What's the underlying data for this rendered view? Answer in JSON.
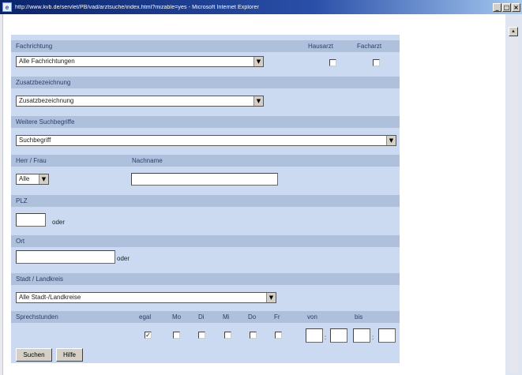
{
  "window": {
    "title": "http://www.kvb.de/servlet/PB/vad/arztsuche/index.html?mizable=yes - Microsoft Internet Explorer",
    "icon": "ie-icon",
    "minimize": "_",
    "restore": "□",
    "close": "×"
  },
  "form": {
    "fachrichtung": {
      "header": "Fachrichtung",
      "hausarzt": "Hausarzt",
      "facharzt": "Facharzt",
      "select_value": "Alle Fachrichtungen"
    },
    "zusatz": {
      "header": "Zusatzbezeichnung",
      "select_value": "Zusatzbezeichnung"
    },
    "suchbegriffe": {
      "header": "Weitere Suchbegriffe",
      "select_value": "Suchbegriff"
    },
    "person": {
      "herr_frau": "Herr / Frau",
      "nachname": "Nachname",
      "anrede_value": "Alle"
    },
    "plz": {
      "header": "PLZ",
      "oder": "oder"
    },
    "ort": {
      "header": "Ort",
      "oder": "oder"
    },
    "kreis": {
      "header": "Stadt / Landkreis",
      "select_value": "Alle Stadt-/Landkreise"
    },
    "sprechstunden": {
      "header": "Sprechstunden",
      "days": [
        "egal",
        "Mo",
        "Di",
        "Mi",
        "Do",
        "Fr"
      ],
      "egal_checked": true,
      "von": "von",
      "bis": "bis",
      "sep": ":"
    },
    "buttons": {
      "suchen": "Suchen",
      "hilfe": "Hilfe"
    }
  },
  "icons": {
    "dropdown": "▼",
    "check": "✓"
  }
}
